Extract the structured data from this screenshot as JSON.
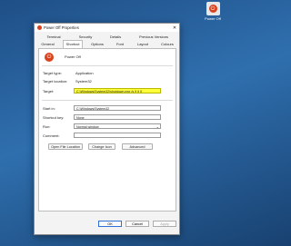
{
  "desktop": {
    "icon_label": "Power Off"
  },
  "dialog": {
    "title": "Power Off Properties",
    "close_glyph": "✕",
    "tabs_row1": [
      "Terminal",
      "Security",
      "Details",
      "Previous Versions"
    ],
    "tabs_row2": [
      "General",
      "Shortcut",
      "Options",
      "Font",
      "Layout",
      "Colours"
    ],
    "active_tab": "Shortcut",
    "name": "Power Off",
    "fields": {
      "target_type_label": "Target type:",
      "target_type_value": "Application",
      "target_location_label": "Target location:",
      "target_location_value": "System32",
      "target_label": "Target:",
      "target_value": "C:\\Windows\\System32\\shutdown.exe /s /f /t 0",
      "start_in_label": "Start in:",
      "start_in_value": "C:\\Windows\\System32",
      "shortcut_key_label": "Shortcut key:",
      "shortcut_key_value": "None",
      "run_label": "Run:",
      "run_value": "Normal window",
      "comment_label": "Comment:",
      "comment_value": ""
    },
    "buttons": {
      "open_location": "Open File Location",
      "change_icon": "Change Icon",
      "advanced": "Advanced",
      "ok": "OK",
      "cancel": "Cancel",
      "apply": "Apply"
    }
  },
  "colors": {
    "highlight": "#ffff3a",
    "accent": "#d9421c"
  }
}
